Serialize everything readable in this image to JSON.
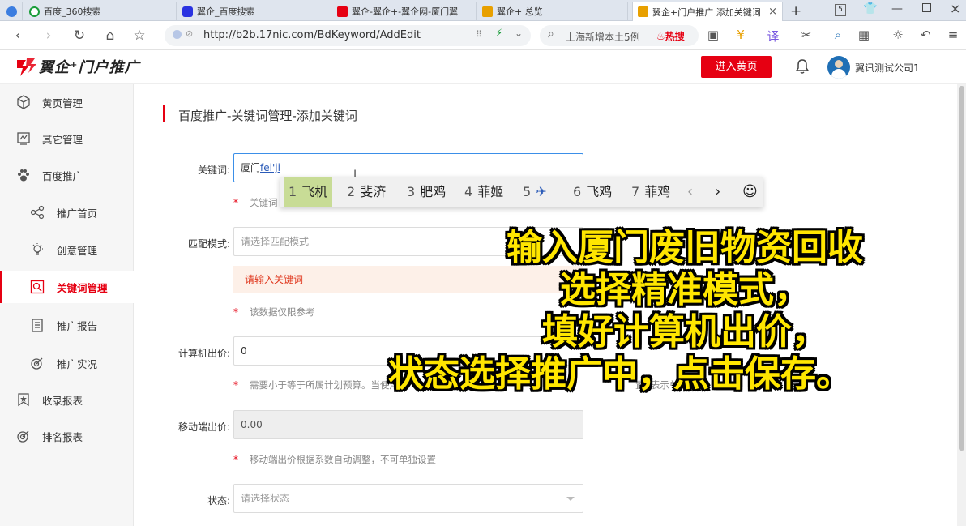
{
  "browser": {
    "tabs": [
      {
        "label": "百度_360搜索",
        "color": "#1a9d3a"
      },
      {
        "label": "翼企_百度搜索",
        "color": "#2932e1"
      },
      {
        "label": "翼企-翼企+-翼企网-厦门翼",
        "color": "#e60012"
      },
      {
        "label": "翼企+ 总览",
        "color": "#e8a000"
      },
      {
        "label": "翼企+门户推广 添加关键词",
        "color": "#e8a000",
        "active": true
      }
    ],
    "tab_count_badge": "5",
    "url": "http://b2b.17nic.com/BdKeyword/AddEdit",
    "search_text": "上海新增本土5例",
    "hot_label": "热搜"
  },
  "app": {
    "logo_text": "翼企⁺门户推广",
    "enter_button": "进入黄页",
    "company": "翼讯测试公司1"
  },
  "sidebar": {
    "items": [
      {
        "label": "黄页管理",
        "icon": "cube-icon"
      },
      {
        "label": "其它管理",
        "icon": "monitor-icon"
      },
      {
        "label": "百度推广",
        "icon": "paw-icon"
      },
      {
        "label": "推广首页",
        "icon": "share-icon"
      },
      {
        "label": "创意管理",
        "icon": "bulb-icon"
      },
      {
        "label": "关键词管理",
        "icon": "search-icon"
      },
      {
        "label": "推广报告",
        "icon": "clipboard-icon"
      },
      {
        "label": "推广实况",
        "icon": "target-icon"
      },
      {
        "label": "收录报表",
        "icon": "star-badge-icon"
      },
      {
        "label": "排名报表",
        "icon": "target-icon"
      }
    ]
  },
  "main": {
    "breadcrumb": "百度推广-关键词管理-添加关键词",
    "form": {
      "keyword_label": "关键词:",
      "keyword_value": "厦门",
      "keyword_pinyin": "fei'ji",
      "keyword_hint_visible": "关键词",
      "match_label": "匹配模式:",
      "match_placeholder": "请选择匹配模式",
      "alert": "请输入关键词",
      "match_hint": "该数据仅限参考",
      "pc_bid_label": "计算机出价:",
      "pc_bid_value": "0",
      "pc_bid_hint": "需要小于等于所属计划预算。当使用单",
      "pc_bid_hint_tail": "置0表示单元出价",
      "mobile_bid_label": "移动端出价:",
      "mobile_bid_value": "0.00",
      "mobile_bid_hint": "移动端出价根据系数自动调整，不可单独设置",
      "status_label": "状态:",
      "status_placeholder": "请选择状态"
    }
  },
  "ime": {
    "candidates": [
      {
        "n": "1",
        "text": "飞机"
      },
      {
        "n": "2",
        "text": "斐济"
      },
      {
        "n": "3",
        "text": "肥鸡"
      },
      {
        "n": "4",
        "text": "菲姬"
      },
      {
        "n": "5",
        "text": "✈"
      },
      {
        "n": "6",
        "text": "飞鸡"
      },
      {
        "n": "7",
        "text": "菲鸡"
      }
    ]
  },
  "caption": {
    "lines": [
      "输入厦门废旧物资回收",
      "选择精准模式，",
      "填好计算机出价，",
      "状态选择推广中，点击保存。"
    ]
  }
}
